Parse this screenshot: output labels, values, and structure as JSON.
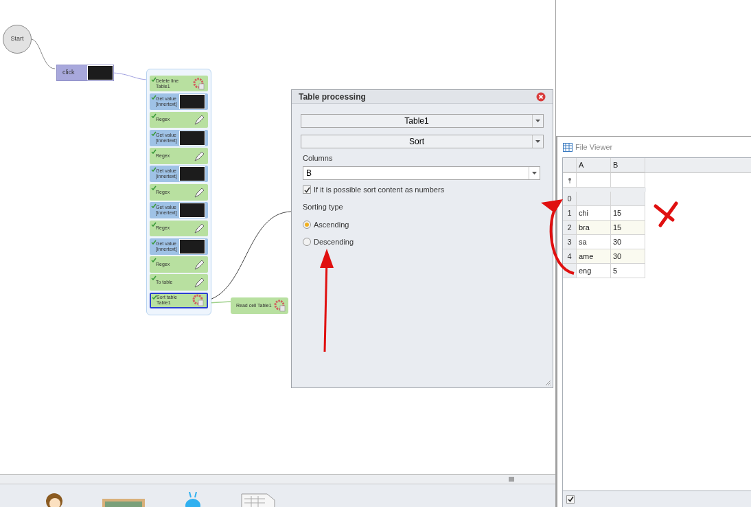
{
  "canvas": {
    "start_node": {
      "label": "Start"
    },
    "click_node": {
      "label": "click"
    },
    "group_nodes": [
      {
        "label": "Delete line Table1",
        "kind": "gear",
        "selected": false
      },
      {
        "label": "Get value [innertext]",
        "kind": "get_value",
        "selected": false
      },
      {
        "label": "Regex",
        "kind": "pen",
        "selected": false
      },
      {
        "label": "Get value [innertext]",
        "kind": "get_value",
        "selected": false
      },
      {
        "label": "Regex",
        "kind": "pen",
        "selected": false
      },
      {
        "label": "Get value [innertext]",
        "kind": "get_value",
        "selected": false
      },
      {
        "label": "Regex",
        "kind": "pen",
        "selected": false
      },
      {
        "label": "Get value [innertext]",
        "kind": "get_value",
        "selected": false
      },
      {
        "label": "Regex",
        "kind": "pen",
        "selected": false
      },
      {
        "label": "Get value [innertext]",
        "kind": "get_value",
        "selected": false
      },
      {
        "label": "Regex",
        "kind": "pen",
        "selected": false
      },
      {
        "label": "To table",
        "kind": "pen",
        "selected": false
      },
      {
        "label": "Sort table Table1",
        "kind": "gear",
        "selected": true
      }
    ],
    "read_node": {
      "label": "Read cell Table1",
      "kind": "gear"
    }
  },
  "dialog": {
    "title": "Table processing",
    "table_select": "Table1",
    "operation_select": "Sort",
    "columns_label": "Columns",
    "columns_value": "B",
    "numbers_checkbox": {
      "label": "If it is possible sort content as numbers",
      "checked": true
    },
    "sorting_type_label": "Sorting type",
    "sorting_options": [
      {
        "label": "Ascending",
        "selected": true
      },
      {
        "label": "Descending",
        "selected": false
      }
    ]
  },
  "file_viewer": {
    "title": "File Viewer",
    "columns": [
      "A",
      "B"
    ],
    "rows": [
      {
        "index": "0",
        "cells": []
      },
      {
        "index": "1",
        "cells": [
          "chi",
          "15"
        ]
      },
      {
        "index": "2",
        "cells": [
          "bra",
          "15"
        ]
      },
      {
        "index": "3",
        "cells": [
          "sa",
          "30"
        ]
      },
      {
        "index": "4",
        "cells": [
          "ame",
          "30"
        ]
      },
      {
        "cells": [
          "eng",
          "5"
        ]
      }
    ],
    "footer_checkbox": {
      "checked": true
    }
  }
}
